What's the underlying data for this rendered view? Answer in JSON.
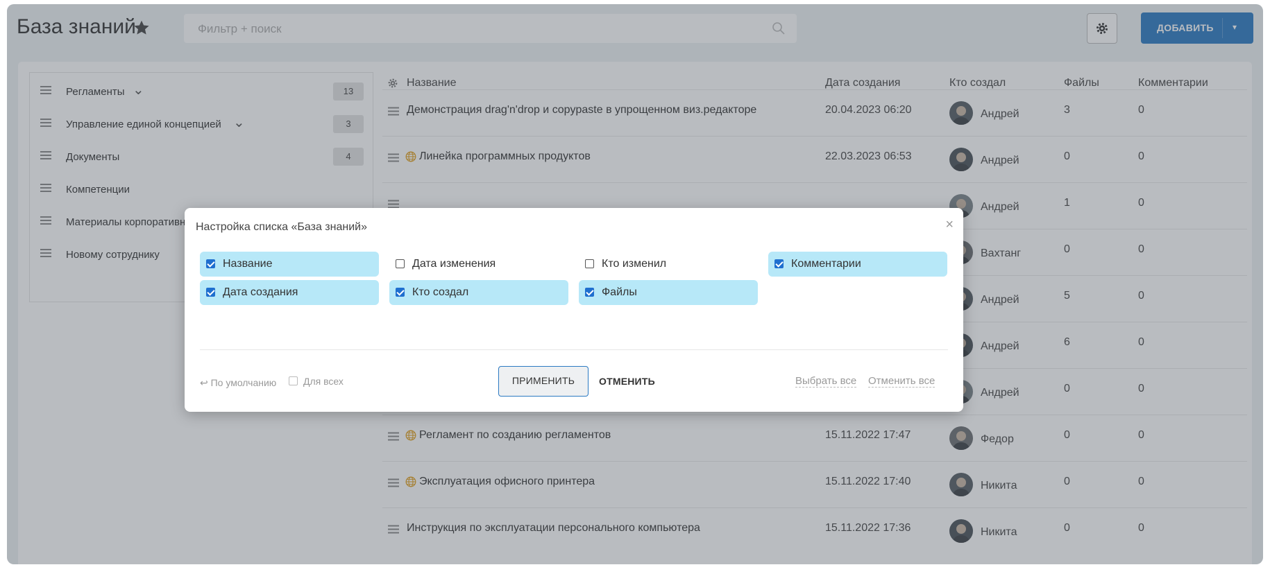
{
  "header": {
    "title": "База знаний",
    "search_placeholder": "Фильтр + поиск",
    "add_label": "ДОБАВИТЬ"
  },
  "sidebar": {
    "items": [
      {
        "label": "Регламенты",
        "count": "13",
        "expandable": true
      },
      {
        "label": "Управление единой концепцией",
        "count": "3",
        "expandable": true
      },
      {
        "label": "Документы",
        "count": "4",
        "expandable": false
      },
      {
        "label": "Компетенции",
        "count": "",
        "expandable": false
      },
      {
        "label": "Материалы корпоративно",
        "count": "",
        "expandable": false
      },
      {
        "label": "Новому сотруднику",
        "count": "",
        "expandable": false
      }
    ]
  },
  "table": {
    "headers": {
      "name": "Название",
      "created": "Дата создания",
      "author": "Кто создал",
      "files": "Файлы",
      "comments": "Комментарии"
    },
    "rows": [
      {
        "title": "Демонстрация drag'n'drop и copypaste в упрощенном виз.редакторе",
        "date": "20.04.2023 06:20",
        "author": "Андрей",
        "files": "3",
        "comments": "0",
        "public": false
      },
      {
        "title": "Линейка программных продуктов",
        "date": "22.03.2023 06:53",
        "author": "Андрей",
        "files": "0",
        "comments": "0",
        "public": true
      },
      {
        "title": "",
        "date": "",
        "author": "Андрей",
        "files": "1",
        "comments": "0",
        "public": false
      },
      {
        "title": "",
        "date": "",
        "author": "Вахтанг",
        "files": "0",
        "comments": "0",
        "public": false
      },
      {
        "title": "",
        "date": "",
        "author": "Андрей",
        "files": "5",
        "comments": "0",
        "public": false
      },
      {
        "title": "",
        "date": "",
        "author": "Андрей",
        "files": "6",
        "comments": "0",
        "public": false
      },
      {
        "title": "",
        "date": "",
        "author": "Андрей",
        "files": "0",
        "comments": "0",
        "public": false
      },
      {
        "title": "Регламент по созданию регламентов",
        "date": "15.11.2022 17:47",
        "author": "Федор",
        "files": "0",
        "comments": "0",
        "public": true
      },
      {
        "title": "Эксплуатация офисного принтера",
        "date": "15.11.2022 17:40",
        "author": "Никита",
        "files": "0",
        "comments": "0",
        "public": true
      },
      {
        "title": "Инструкция по эксплуатации персонального компьютера",
        "date": "15.11.2022 17:36",
        "author": "Никита",
        "files": "0",
        "comments": "0",
        "public": false
      }
    ]
  },
  "modal": {
    "title": "Настройка списка «База знаний»",
    "options": [
      {
        "label": "Название",
        "checked": true
      },
      {
        "label": "Дата изменения",
        "checked": false
      },
      {
        "label": "Кто изменил",
        "checked": false
      },
      {
        "label": "Комментарии",
        "checked": true
      },
      {
        "label": "Дата создания",
        "checked": true
      },
      {
        "label": "Кто создал",
        "checked": true
      },
      {
        "label": "Файлы",
        "checked": true
      }
    ],
    "default_label": "↩ По умолчанию",
    "for_all_label": "Для всех",
    "apply_label": "ПРИМЕНИТЬ",
    "cancel_label": "ОТМЕНИТЬ",
    "select_all_label": "Выбрать все",
    "unselect_all_label": "Отменить все"
  },
  "colors": {
    "primary": "#2b79c2",
    "option_selected": "#b7e8f8",
    "checkbox": "#1f6fcf",
    "public_icon": "#e0a020"
  }
}
